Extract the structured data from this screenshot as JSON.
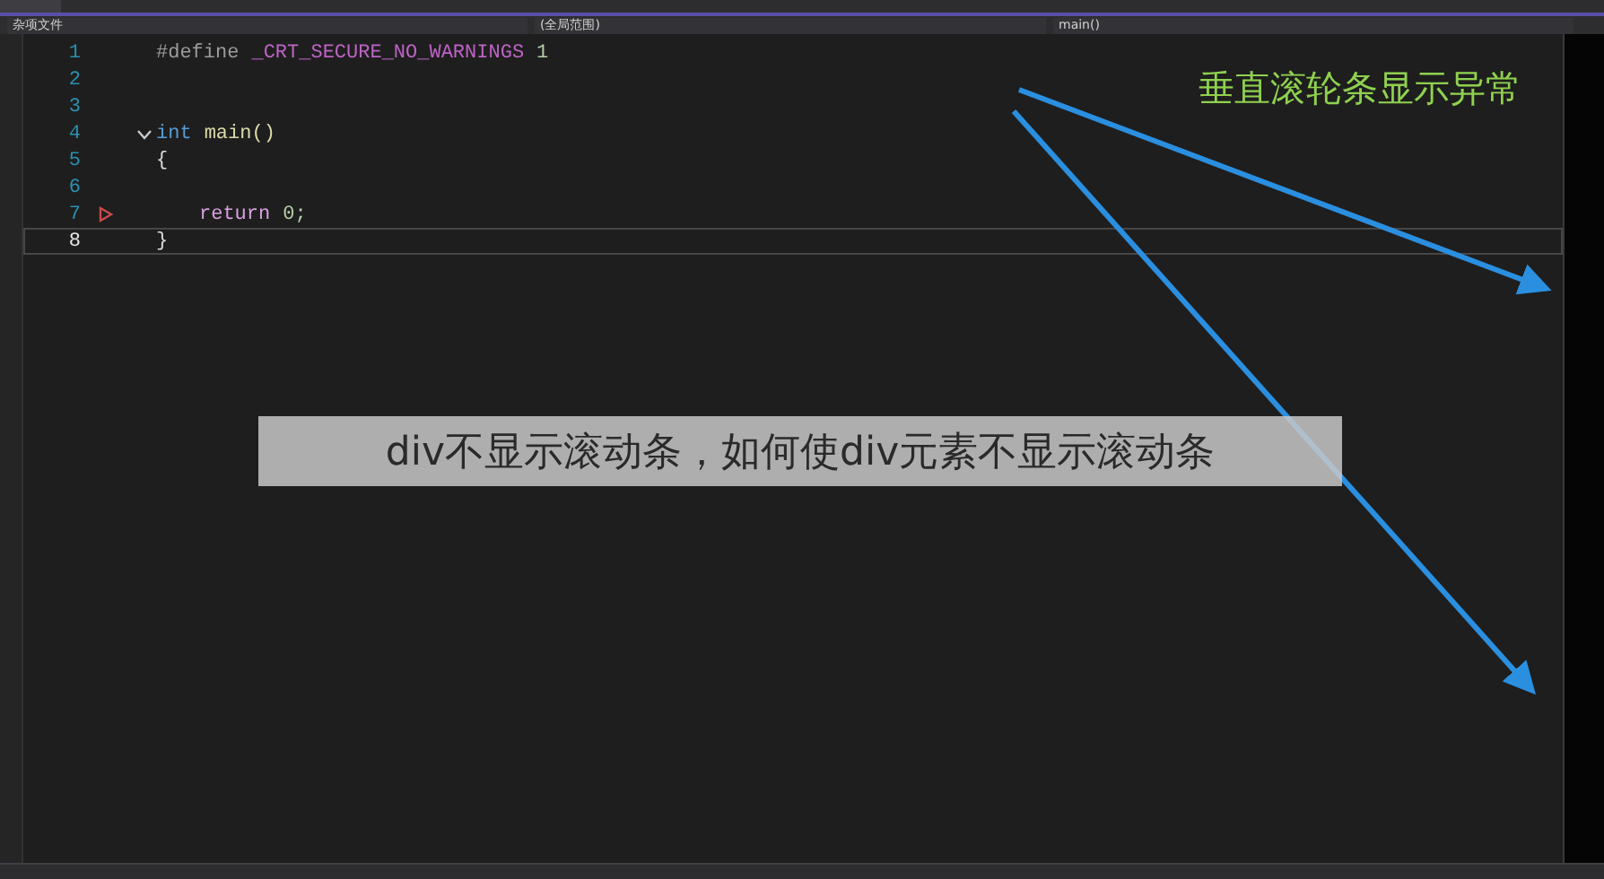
{
  "navigation_bar": {
    "project": "杂项文件",
    "scope": "(全局范围)",
    "member": "main()"
  },
  "editor": {
    "lines": [
      {
        "number": "1",
        "indented": false,
        "fold": false,
        "marker": false,
        "current": false,
        "tokens": [
          {
            "kind": "directive",
            "text": "#define"
          },
          {
            "kind": "macro",
            "text": "_CRT_SECURE_NO_WARNINGS"
          },
          {
            "kind": "number",
            "text": "1"
          }
        ]
      },
      {
        "number": "2",
        "fold": false,
        "marker": false,
        "current": false
      },
      {
        "number": "3",
        "fold": false,
        "marker": false,
        "current": false
      },
      {
        "number": "4",
        "indented": false,
        "fold": true,
        "marker": false,
        "current": false,
        "tokens": [
          {
            "kind": "keyword",
            "text": "int"
          },
          {
            "kind": "function",
            "text": "main()"
          }
        ]
      },
      {
        "number": "5",
        "indented": false,
        "fold": false,
        "marker": false,
        "current": false,
        "tokens": [
          {
            "kind": "plain",
            "text": "{"
          }
        ]
      },
      {
        "number": "6",
        "fold": false,
        "marker": false,
        "current": false
      },
      {
        "number": "7",
        "indented": true,
        "fold": false,
        "marker": true,
        "current": false,
        "tokens": [
          {
            "kind": "control",
            "text": "return"
          },
          {
            "kind": "number",
            "text": "0;"
          }
        ]
      },
      {
        "number": "8",
        "indented": false,
        "fold": false,
        "marker": false,
        "current": true,
        "tokens": [
          {
            "kind": "plain",
            "text": "}"
          }
        ]
      }
    ]
  },
  "annotation": {
    "text": "垂直滚轮条显示异常"
  },
  "banner": {
    "text": "div不显示滚动条，如何使div元素不显示滚动条"
  }
}
